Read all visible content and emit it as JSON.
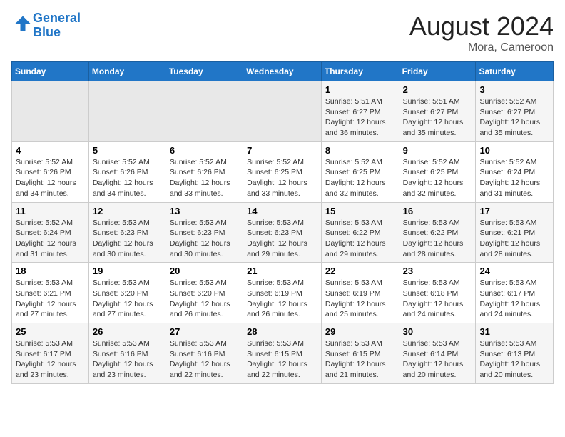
{
  "header": {
    "logo_line1": "General",
    "logo_line2": "Blue",
    "main_title": "August 2024",
    "subtitle": "Mora, Cameroon"
  },
  "days_of_week": [
    "Sunday",
    "Monday",
    "Tuesday",
    "Wednesday",
    "Thursday",
    "Friday",
    "Saturday"
  ],
  "weeks": [
    [
      {
        "day": "",
        "detail": ""
      },
      {
        "day": "",
        "detail": ""
      },
      {
        "day": "",
        "detail": ""
      },
      {
        "day": "",
        "detail": ""
      },
      {
        "day": "1",
        "detail": "Sunrise: 5:51 AM\nSunset: 6:27 PM\nDaylight: 12 hours\nand 36 minutes."
      },
      {
        "day": "2",
        "detail": "Sunrise: 5:51 AM\nSunset: 6:27 PM\nDaylight: 12 hours\nand 35 minutes."
      },
      {
        "day": "3",
        "detail": "Sunrise: 5:52 AM\nSunset: 6:27 PM\nDaylight: 12 hours\nand 35 minutes."
      }
    ],
    [
      {
        "day": "4",
        "detail": "Sunrise: 5:52 AM\nSunset: 6:26 PM\nDaylight: 12 hours\nand 34 minutes."
      },
      {
        "day": "5",
        "detail": "Sunrise: 5:52 AM\nSunset: 6:26 PM\nDaylight: 12 hours\nand 34 minutes."
      },
      {
        "day": "6",
        "detail": "Sunrise: 5:52 AM\nSunset: 6:26 PM\nDaylight: 12 hours\nand 33 minutes."
      },
      {
        "day": "7",
        "detail": "Sunrise: 5:52 AM\nSunset: 6:25 PM\nDaylight: 12 hours\nand 33 minutes."
      },
      {
        "day": "8",
        "detail": "Sunrise: 5:52 AM\nSunset: 6:25 PM\nDaylight: 12 hours\nand 32 minutes."
      },
      {
        "day": "9",
        "detail": "Sunrise: 5:52 AM\nSunset: 6:25 PM\nDaylight: 12 hours\nand 32 minutes."
      },
      {
        "day": "10",
        "detail": "Sunrise: 5:52 AM\nSunset: 6:24 PM\nDaylight: 12 hours\nand 31 minutes."
      }
    ],
    [
      {
        "day": "11",
        "detail": "Sunrise: 5:52 AM\nSunset: 6:24 PM\nDaylight: 12 hours\nand 31 minutes."
      },
      {
        "day": "12",
        "detail": "Sunrise: 5:53 AM\nSunset: 6:23 PM\nDaylight: 12 hours\nand 30 minutes."
      },
      {
        "day": "13",
        "detail": "Sunrise: 5:53 AM\nSunset: 6:23 PM\nDaylight: 12 hours\nand 30 minutes."
      },
      {
        "day": "14",
        "detail": "Sunrise: 5:53 AM\nSunset: 6:23 PM\nDaylight: 12 hours\nand 29 minutes."
      },
      {
        "day": "15",
        "detail": "Sunrise: 5:53 AM\nSunset: 6:22 PM\nDaylight: 12 hours\nand 29 minutes."
      },
      {
        "day": "16",
        "detail": "Sunrise: 5:53 AM\nSunset: 6:22 PM\nDaylight: 12 hours\nand 28 minutes."
      },
      {
        "day": "17",
        "detail": "Sunrise: 5:53 AM\nSunset: 6:21 PM\nDaylight: 12 hours\nand 28 minutes."
      }
    ],
    [
      {
        "day": "18",
        "detail": "Sunrise: 5:53 AM\nSunset: 6:21 PM\nDaylight: 12 hours\nand 27 minutes."
      },
      {
        "day": "19",
        "detail": "Sunrise: 5:53 AM\nSunset: 6:20 PM\nDaylight: 12 hours\nand 27 minutes."
      },
      {
        "day": "20",
        "detail": "Sunrise: 5:53 AM\nSunset: 6:20 PM\nDaylight: 12 hours\nand 26 minutes."
      },
      {
        "day": "21",
        "detail": "Sunrise: 5:53 AM\nSunset: 6:19 PM\nDaylight: 12 hours\nand 26 minutes."
      },
      {
        "day": "22",
        "detail": "Sunrise: 5:53 AM\nSunset: 6:19 PM\nDaylight: 12 hours\nand 25 minutes."
      },
      {
        "day": "23",
        "detail": "Sunrise: 5:53 AM\nSunset: 6:18 PM\nDaylight: 12 hours\nand 24 minutes."
      },
      {
        "day": "24",
        "detail": "Sunrise: 5:53 AM\nSunset: 6:17 PM\nDaylight: 12 hours\nand 24 minutes."
      }
    ],
    [
      {
        "day": "25",
        "detail": "Sunrise: 5:53 AM\nSunset: 6:17 PM\nDaylight: 12 hours\nand 23 minutes."
      },
      {
        "day": "26",
        "detail": "Sunrise: 5:53 AM\nSunset: 6:16 PM\nDaylight: 12 hours\nand 23 minutes."
      },
      {
        "day": "27",
        "detail": "Sunrise: 5:53 AM\nSunset: 6:16 PM\nDaylight: 12 hours\nand 22 minutes."
      },
      {
        "day": "28",
        "detail": "Sunrise: 5:53 AM\nSunset: 6:15 PM\nDaylight: 12 hours\nand 22 minutes."
      },
      {
        "day": "29",
        "detail": "Sunrise: 5:53 AM\nSunset: 6:15 PM\nDaylight: 12 hours\nand 21 minutes."
      },
      {
        "day": "30",
        "detail": "Sunrise: 5:53 AM\nSunset: 6:14 PM\nDaylight: 12 hours\nand 20 minutes."
      },
      {
        "day": "31",
        "detail": "Sunrise: 5:53 AM\nSunset: 6:13 PM\nDaylight: 12 hours\nand 20 minutes."
      }
    ]
  ]
}
